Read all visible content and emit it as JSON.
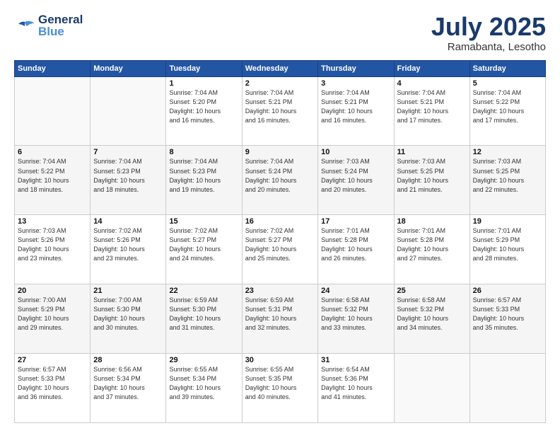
{
  "header": {
    "logo_line1": "General",
    "logo_line2": "Blue",
    "month": "July 2025",
    "location": "Ramabanta, Lesotho"
  },
  "weekdays": [
    "Sunday",
    "Monday",
    "Tuesday",
    "Wednesday",
    "Thursday",
    "Friday",
    "Saturday"
  ],
  "weeks": [
    [
      {
        "day": "",
        "info": ""
      },
      {
        "day": "",
        "info": ""
      },
      {
        "day": "1",
        "info": "Sunrise: 7:04 AM\nSunset: 5:20 PM\nDaylight: 10 hours\nand 16 minutes."
      },
      {
        "day": "2",
        "info": "Sunrise: 7:04 AM\nSunset: 5:21 PM\nDaylight: 10 hours\nand 16 minutes."
      },
      {
        "day": "3",
        "info": "Sunrise: 7:04 AM\nSunset: 5:21 PM\nDaylight: 10 hours\nand 16 minutes."
      },
      {
        "day": "4",
        "info": "Sunrise: 7:04 AM\nSunset: 5:21 PM\nDaylight: 10 hours\nand 17 minutes."
      },
      {
        "day": "5",
        "info": "Sunrise: 7:04 AM\nSunset: 5:22 PM\nDaylight: 10 hours\nand 17 minutes."
      }
    ],
    [
      {
        "day": "6",
        "info": "Sunrise: 7:04 AM\nSunset: 5:22 PM\nDaylight: 10 hours\nand 18 minutes."
      },
      {
        "day": "7",
        "info": "Sunrise: 7:04 AM\nSunset: 5:23 PM\nDaylight: 10 hours\nand 18 minutes."
      },
      {
        "day": "8",
        "info": "Sunrise: 7:04 AM\nSunset: 5:23 PM\nDaylight: 10 hours\nand 19 minutes."
      },
      {
        "day": "9",
        "info": "Sunrise: 7:04 AM\nSunset: 5:24 PM\nDaylight: 10 hours\nand 20 minutes."
      },
      {
        "day": "10",
        "info": "Sunrise: 7:03 AM\nSunset: 5:24 PM\nDaylight: 10 hours\nand 20 minutes."
      },
      {
        "day": "11",
        "info": "Sunrise: 7:03 AM\nSunset: 5:25 PM\nDaylight: 10 hours\nand 21 minutes."
      },
      {
        "day": "12",
        "info": "Sunrise: 7:03 AM\nSunset: 5:25 PM\nDaylight: 10 hours\nand 22 minutes."
      }
    ],
    [
      {
        "day": "13",
        "info": "Sunrise: 7:03 AM\nSunset: 5:26 PM\nDaylight: 10 hours\nand 23 minutes."
      },
      {
        "day": "14",
        "info": "Sunrise: 7:02 AM\nSunset: 5:26 PM\nDaylight: 10 hours\nand 23 minutes."
      },
      {
        "day": "15",
        "info": "Sunrise: 7:02 AM\nSunset: 5:27 PM\nDaylight: 10 hours\nand 24 minutes."
      },
      {
        "day": "16",
        "info": "Sunrise: 7:02 AM\nSunset: 5:27 PM\nDaylight: 10 hours\nand 25 minutes."
      },
      {
        "day": "17",
        "info": "Sunrise: 7:01 AM\nSunset: 5:28 PM\nDaylight: 10 hours\nand 26 minutes."
      },
      {
        "day": "18",
        "info": "Sunrise: 7:01 AM\nSunset: 5:28 PM\nDaylight: 10 hours\nand 27 minutes."
      },
      {
        "day": "19",
        "info": "Sunrise: 7:01 AM\nSunset: 5:29 PM\nDaylight: 10 hours\nand 28 minutes."
      }
    ],
    [
      {
        "day": "20",
        "info": "Sunrise: 7:00 AM\nSunset: 5:29 PM\nDaylight: 10 hours\nand 29 minutes."
      },
      {
        "day": "21",
        "info": "Sunrise: 7:00 AM\nSunset: 5:30 PM\nDaylight: 10 hours\nand 30 minutes."
      },
      {
        "day": "22",
        "info": "Sunrise: 6:59 AM\nSunset: 5:30 PM\nDaylight: 10 hours\nand 31 minutes."
      },
      {
        "day": "23",
        "info": "Sunrise: 6:59 AM\nSunset: 5:31 PM\nDaylight: 10 hours\nand 32 minutes."
      },
      {
        "day": "24",
        "info": "Sunrise: 6:58 AM\nSunset: 5:32 PM\nDaylight: 10 hours\nand 33 minutes."
      },
      {
        "day": "25",
        "info": "Sunrise: 6:58 AM\nSunset: 5:32 PM\nDaylight: 10 hours\nand 34 minutes."
      },
      {
        "day": "26",
        "info": "Sunrise: 6:57 AM\nSunset: 5:33 PM\nDaylight: 10 hours\nand 35 minutes."
      }
    ],
    [
      {
        "day": "27",
        "info": "Sunrise: 6:57 AM\nSunset: 5:33 PM\nDaylight: 10 hours\nand 36 minutes."
      },
      {
        "day": "28",
        "info": "Sunrise: 6:56 AM\nSunset: 5:34 PM\nDaylight: 10 hours\nand 37 minutes."
      },
      {
        "day": "29",
        "info": "Sunrise: 6:55 AM\nSunset: 5:34 PM\nDaylight: 10 hours\nand 39 minutes."
      },
      {
        "day": "30",
        "info": "Sunrise: 6:55 AM\nSunset: 5:35 PM\nDaylight: 10 hours\nand 40 minutes."
      },
      {
        "day": "31",
        "info": "Sunrise: 6:54 AM\nSunset: 5:36 PM\nDaylight: 10 hours\nand 41 minutes."
      },
      {
        "day": "",
        "info": ""
      },
      {
        "day": "",
        "info": ""
      }
    ]
  ]
}
